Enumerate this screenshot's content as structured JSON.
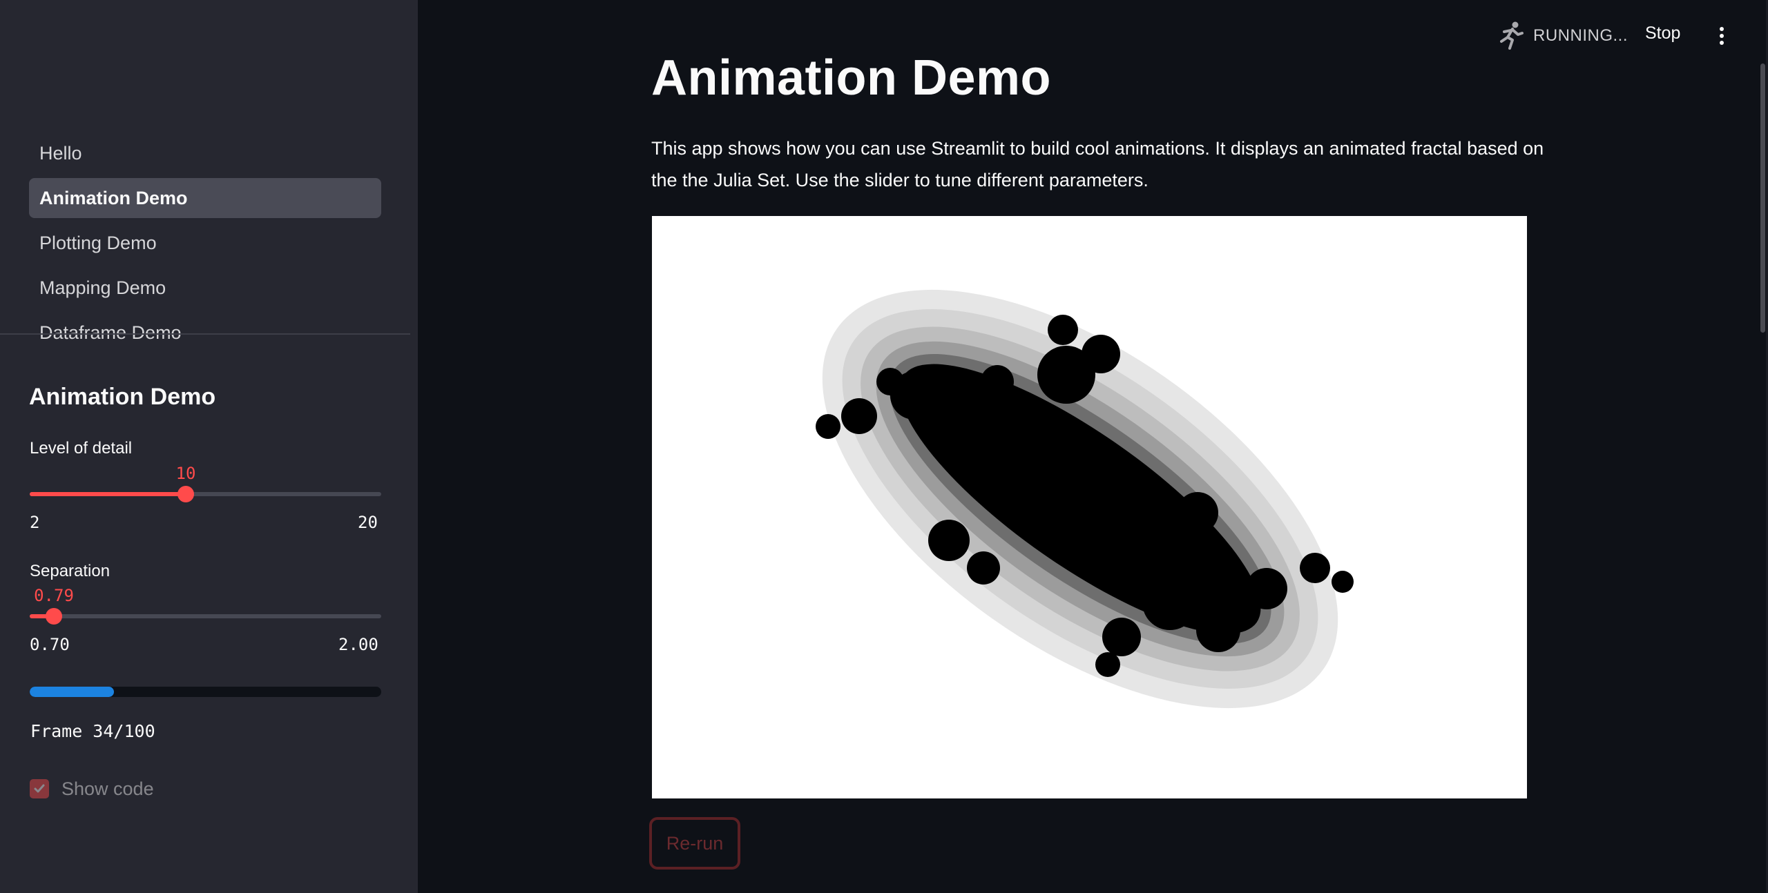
{
  "sidebar": {
    "nav_items": [
      {
        "label": "Hello",
        "active": false
      },
      {
        "label": "Animation Demo",
        "active": true
      },
      {
        "label": "Plotting Demo",
        "active": false
      },
      {
        "label": "Mapping Demo",
        "active": false
      },
      {
        "label": "Dataframe Demo",
        "active": false
      }
    ],
    "section_title": "Animation Demo",
    "detail_slider": {
      "label": "Level of detail",
      "value": "10",
      "min": "2",
      "max": "20",
      "fraction": 0.444
    },
    "separation_slider": {
      "label": "Separation",
      "value": "0.79",
      "min": "0.70",
      "max": "2.00",
      "fraction": 0.069
    },
    "progress": {
      "fraction": 0.24
    },
    "frame_text": "Frame 34/100",
    "show_code": {
      "label": "Show code",
      "checked": true
    }
  },
  "header": {
    "status_text": "RUNNING...",
    "running_icon": "running-man-icon",
    "stop_label": "Stop",
    "menu_icon": "vertical-ellipsis-icon"
  },
  "main": {
    "title": "Animation Demo",
    "description": "This app shows how you can use Streamlit to build cool animations. It displays an animated fractal based on the the Julia Set. Use the slider to tune different parameters.",
    "rerun_label": "Re-run"
  },
  "colors": {
    "accent": "#ff4b4b",
    "progress": "#1c83e1",
    "sidebar_bg": "#262730",
    "main_bg": "#0e1117"
  }
}
